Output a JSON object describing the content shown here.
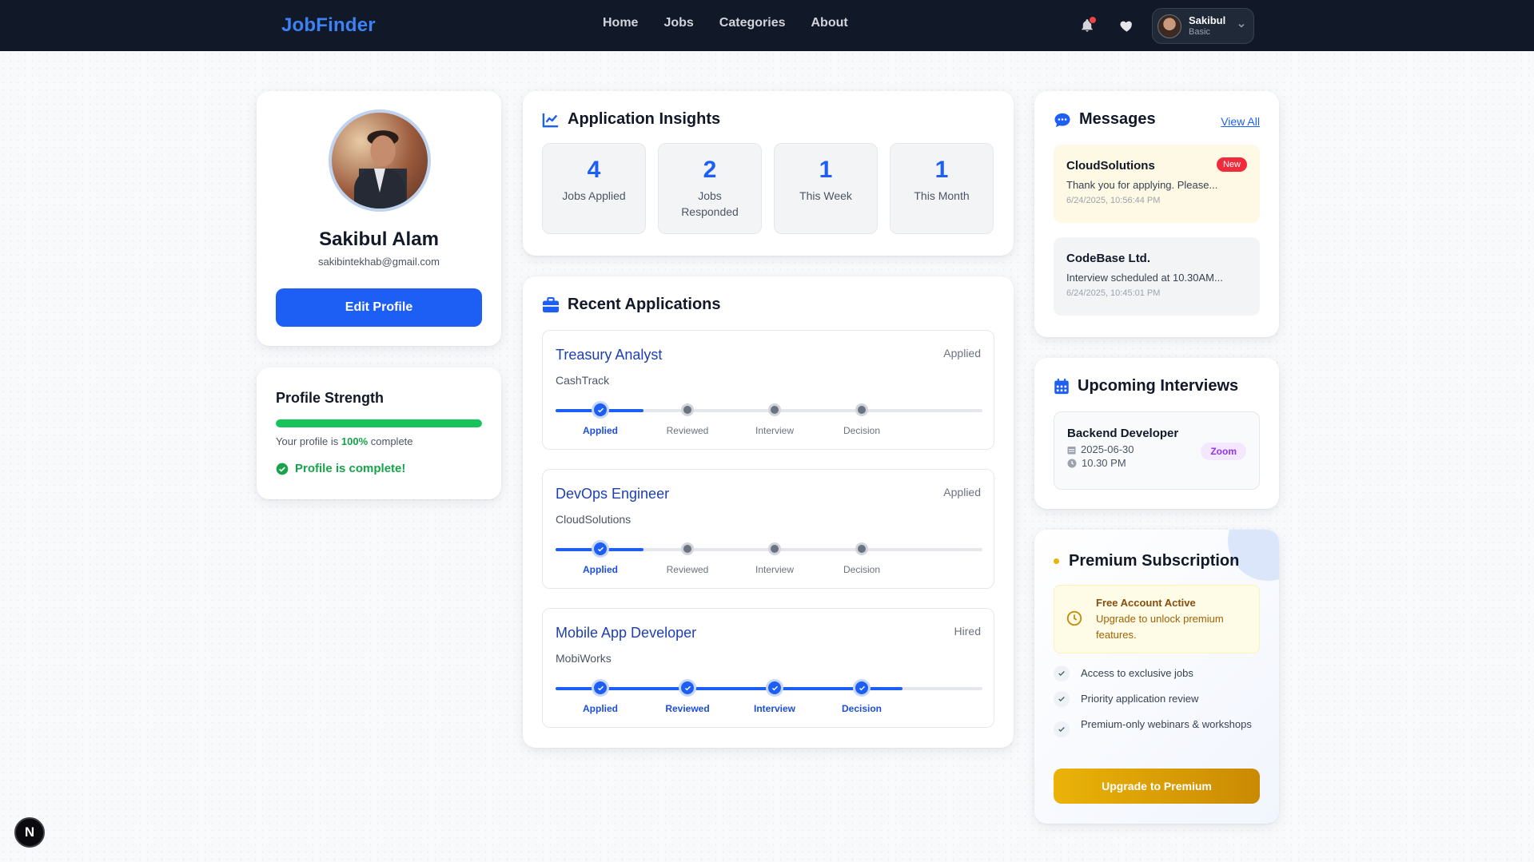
{
  "nav": {
    "brand": "JobFinder",
    "links": [
      "Home",
      "Jobs",
      "Categories",
      "About"
    ],
    "user": {
      "name": "Sakibul",
      "plan": "Basic"
    },
    "icons": [
      "bell-icon",
      "heart-icon",
      "chevron-down-icon"
    ]
  },
  "profile": {
    "name": "Sakibul Alam",
    "email": "sakibintekhab@gmail.com",
    "edit_label": "Edit Profile"
  },
  "strength": {
    "title": "Profile Strength",
    "percent": 100,
    "text_prefix": "Your profile is ",
    "percent_label": "100%",
    "text_suffix": " complete",
    "complete_label": "Profile is complete!"
  },
  "insights": {
    "title": "Application Insights",
    "stats": [
      {
        "value": "4",
        "label": "Jobs Applied"
      },
      {
        "value": "2",
        "label": "Jobs Responded"
      },
      {
        "value": "1",
        "label": "This Week"
      },
      {
        "value": "1",
        "label": "This Month"
      }
    ]
  },
  "recent": {
    "title": "Recent Applications",
    "steps": [
      "Applied",
      "Reviewed",
      "Interview",
      "Decision"
    ],
    "items": [
      {
        "title": "Treasury Analyst",
        "company": "CashTrack",
        "status": "Applied",
        "progress_steps": 1
      },
      {
        "title": "DevOps Engineer",
        "company": "CloudSolutions",
        "status": "Applied",
        "progress_steps": 1
      },
      {
        "title": "Mobile App Developer",
        "company": "MobiWorks",
        "status": "Hired",
        "progress_steps": 4
      }
    ]
  },
  "messages": {
    "title": "Messages",
    "view_all": "View All",
    "items": [
      {
        "from": "CloudSolutions",
        "body": "Thank you for applying. Please...",
        "time": "6/24/2025, 10:56:44 PM",
        "badge": "New"
      },
      {
        "from": "CodeBase Ltd.",
        "body": "Interview scheduled at 10.30AM...",
        "time": "6/24/2025, 10:45:01 PM"
      }
    ]
  },
  "interviews": {
    "title": "Upcoming Interviews",
    "items": [
      {
        "role": "Backend Developer",
        "date": "2025-06-30",
        "time": "10.30 PM",
        "platform": "Zoom"
      }
    ]
  },
  "premium": {
    "title": "Premium Subscription",
    "free_title": "Free Account Active",
    "free_sub": "Upgrade to unlock premium features.",
    "features": [
      "Access to exclusive jobs",
      "Priority application review",
      "Premium-only webinars & workshops"
    ],
    "button": "Upgrade to Premium"
  },
  "dev_badge": "N",
  "colors": {
    "nav_bg": "#111827",
    "accent": "#1d5ff5",
    "success": "#16a34a",
    "premium": "#eab308"
  }
}
